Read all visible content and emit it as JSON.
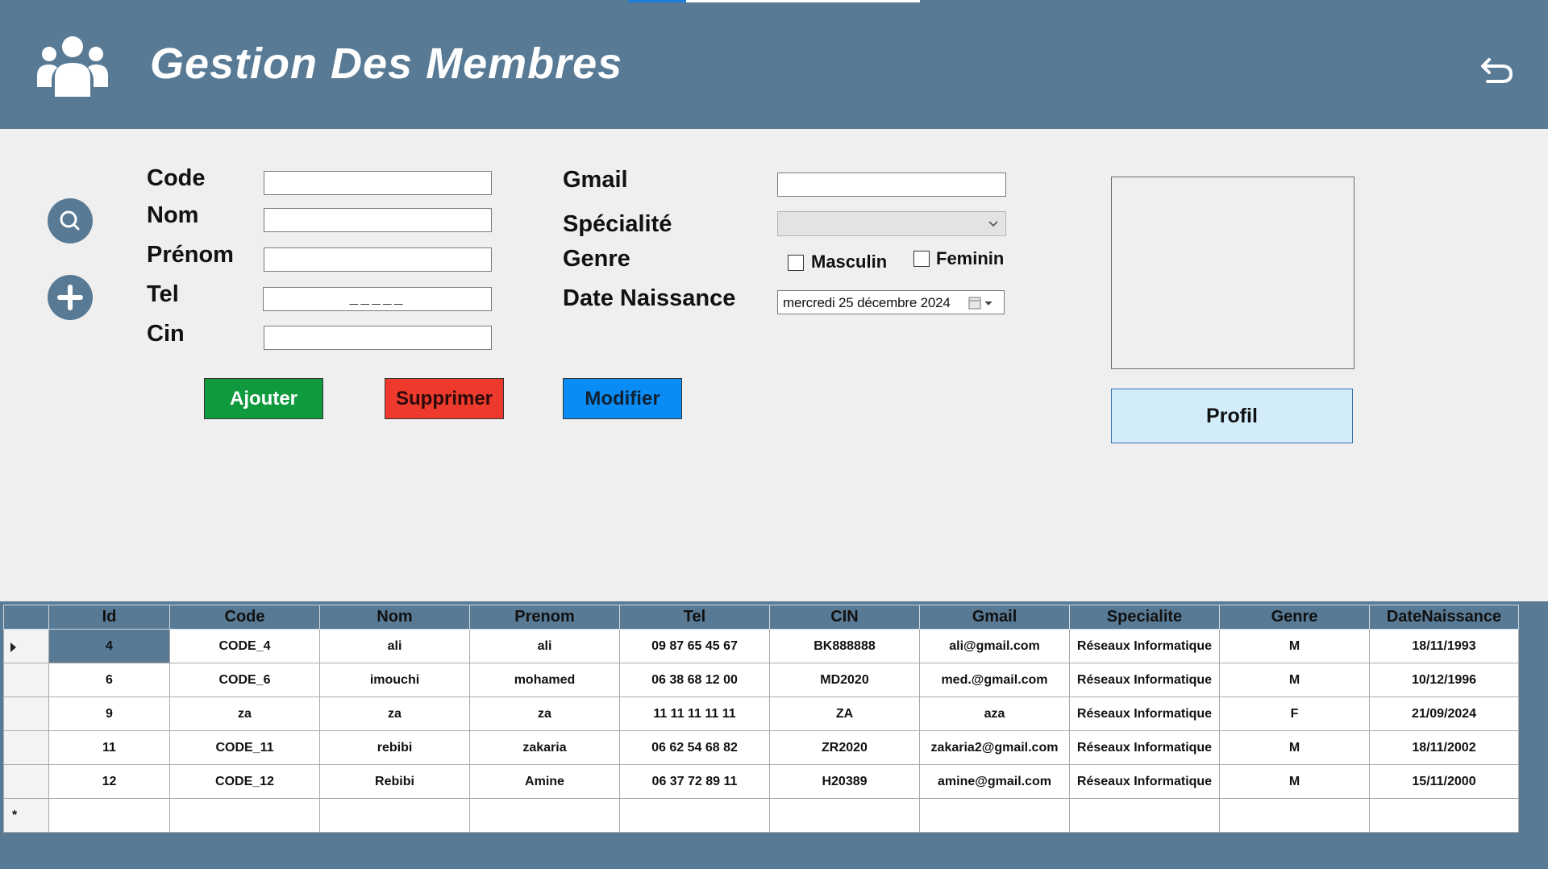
{
  "header": {
    "title": "Gestion Des Membres",
    "people_icon": "people-group-icon",
    "back_icon": "undo-arrow-icon",
    "bg_color": "#587a95"
  },
  "side_actions": {
    "search_icon": "search-icon",
    "add_icon": "plus-icon"
  },
  "form": {
    "code_label": "Code",
    "nom_label": "Nom",
    "prenom_label": "Prénom",
    "tel_label": "Tel",
    "cin_label": "Cin",
    "gmail_label": "Gmail",
    "specialite_label": "Spécialité",
    "genre_label": "Genre",
    "date_label": "Date Naissance",
    "code_value": "",
    "nom_value": "",
    "prenom_value": "",
    "tel_mask": "_____",
    "cin_value": "",
    "gmail_value": "",
    "specialite_value": "",
    "masculin_label": "Masculin",
    "feminin_label": "Feminin",
    "masculin_checked": false,
    "feminin_checked": false,
    "date_value": "mercredi  25 décembre  2024"
  },
  "buttons": {
    "ajouter": "Ajouter",
    "supprimer": "Supprimer",
    "modifier": "Modifier",
    "profil": "Profil",
    "ajouter_color": "#0f9a3d",
    "supprimer_color": "#ee3a2d",
    "modifier_color": "#0a8cf6"
  },
  "table": {
    "columns": [
      "Id",
      "Code",
      "Nom",
      "Prenom",
      "Tel",
      "CIN",
      "Gmail",
      "Specialite",
      "Genre",
      "DateNaissance"
    ],
    "rows": [
      [
        "4",
        "CODE_4",
        "ali",
        "ali",
        "09 87 65 45 67",
        "BK888888",
        "ali@gmail.com",
        "Réseaux Informatique",
        "M",
        "18/11/1993"
      ],
      [
        "6",
        "CODE_6",
        "imouchi",
        "mohamed",
        "06 38 68 12 00",
        "MD2020",
        "med.@gmail.com",
        "Réseaux Informatique",
        "M",
        "10/12/1996"
      ],
      [
        "9",
        "za",
        "za",
        "za",
        "11 11 11 11 11",
        "ZA",
        "aza",
        "Réseaux Informatique",
        "F",
        "21/09/2024"
      ],
      [
        "11",
        "CODE_11",
        "rebibi",
        "zakaria",
        "06 62 54 68 82",
        "ZR2020",
        "zakaria2@gmail.com",
        "Réseaux Informatique",
        "M",
        "18/11/2002"
      ],
      [
        "12",
        "CODE_12",
        "Rebibi",
        "Amine",
        "06 37 72 89 11",
        "H20389",
        "amine@gmail.com",
        "Réseaux Informatique",
        "M",
        "15/11/2000"
      ]
    ],
    "new_row_marker": "*",
    "current_row_icon": "row-pointer-icon"
  }
}
